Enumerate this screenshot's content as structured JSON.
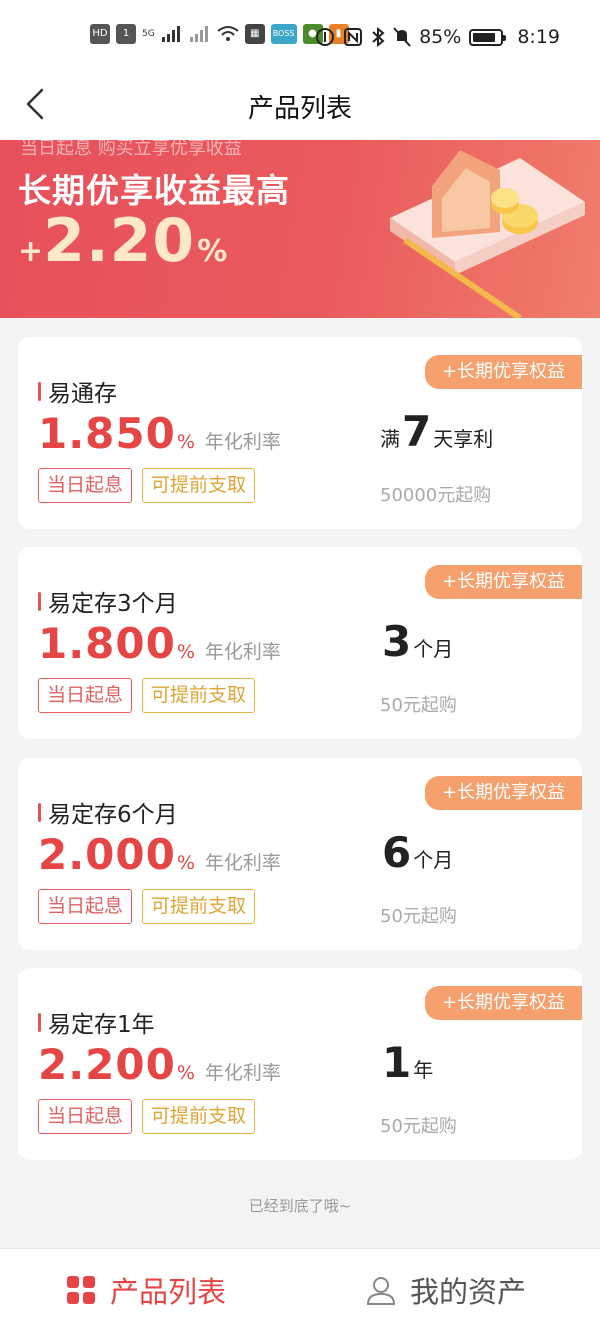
{
  "status_bar": {
    "chips": [
      "HD",
      "1",
      "5G",
      "BOSS"
    ],
    "battery_level": "85%",
    "battery_fraction": 0.85,
    "time": "8:19",
    "icons": [
      "signal-icon",
      "wifi-icon",
      "nfc-icon",
      "bluetooth-icon",
      "mute-bell-icon",
      "battery-icon"
    ]
  },
  "nav": {
    "title": "产品列表",
    "back_icon": "chevron-left-icon"
  },
  "banner": {
    "top_text": "当日起息 购买立享优享收益",
    "headline": "长期优享收益最高",
    "rate_plus": "+",
    "rate_value": "2.20",
    "rate_unit": "%"
  },
  "products": [
    {
      "tag": "+长期优享权益",
      "name": "易通存",
      "rate": "1.850",
      "rate_unit": "%",
      "rate_label": "年化利率",
      "chips": [
        "当日起息",
        "可提前支取"
      ],
      "term_prefix": "满",
      "term_value": "7",
      "term_suffix": "天享利",
      "min_purchase": "50000元起购"
    },
    {
      "tag": "+长期优享权益",
      "name": "易定存3个月",
      "rate": "1.800",
      "rate_unit": "%",
      "rate_label": "年化利率",
      "chips": [
        "当日起息",
        "可提前支取"
      ],
      "term_prefix": "",
      "term_value": "3",
      "term_suffix": "个月",
      "min_purchase": "50元起购"
    },
    {
      "tag": "+长期优享权益",
      "name": "易定存6个月",
      "rate": "2.000",
      "rate_unit": "%",
      "rate_label": "年化利率",
      "chips": [
        "当日起息",
        "可提前支取"
      ],
      "term_prefix": "",
      "term_value": "6",
      "term_suffix": "个月",
      "min_purchase": "50元起购"
    },
    {
      "tag": "+长期优享权益",
      "name": "易定存1年",
      "rate": "2.200",
      "rate_unit": "%",
      "rate_label": "年化利率",
      "chips": [
        "当日起息",
        "可提前支取"
      ],
      "term_prefix": "",
      "term_value": "1",
      "term_suffix": "年",
      "min_purchase": "50元起购"
    }
  ],
  "footer_note": "已经到底了哦~",
  "tabbar": {
    "products_label": "产品列表",
    "products_icon": "grid-icon",
    "assets_label": "我的资产",
    "assets_icon": "user-icon",
    "active": "products"
  },
  "colors": {
    "accent_red": "#e64545",
    "tag_orange": "#f6a06e",
    "chip_gold": "#e0a437",
    "banner_red": "#e8505b"
  }
}
